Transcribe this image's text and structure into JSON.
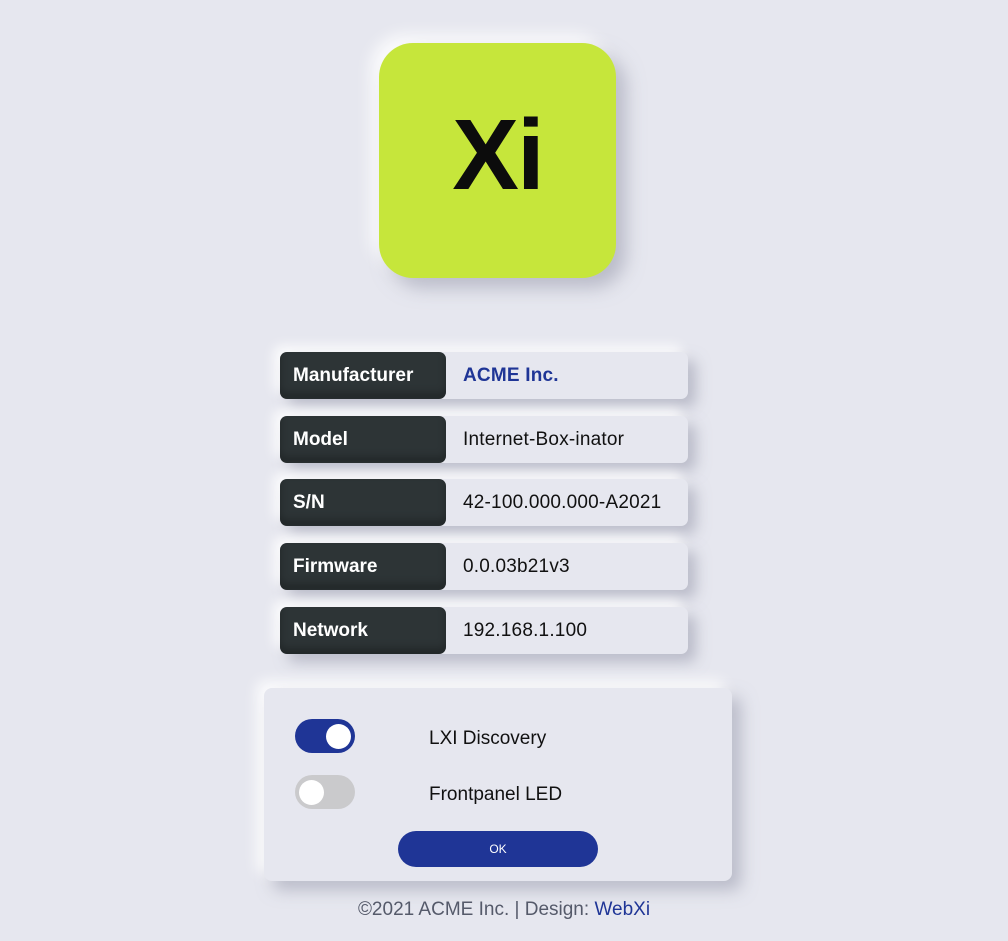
{
  "logo": {
    "text": "Xi",
    "color": "#c6e63b"
  },
  "info": [
    {
      "label": "Manufacturer",
      "value": "ACME Inc."
    },
    {
      "label": "Model",
      "value": "Internet-Box-inator"
    },
    {
      "label": "S/N",
      "value": "42-100.000.000-A2021"
    },
    {
      "label": "Firmware",
      "value": "0.0.03b21v3"
    },
    {
      "label": "Network",
      "value": "192.168.1.100"
    }
  ],
  "settings": {
    "lxi_discovery": {
      "label": "LXI Discovery",
      "enabled": true
    },
    "frontpanel_led": {
      "label": "Frontpanel LED",
      "enabled": false
    },
    "ok_label": "OK"
  },
  "footer": {
    "prefix": "©2021 ACME Inc. | Design: ",
    "design_link": "WebXi"
  },
  "colors": {
    "accent": "#1f3596",
    "label_bg": "#2d3436",
    "background": "#e6e7ef"
  }
}
